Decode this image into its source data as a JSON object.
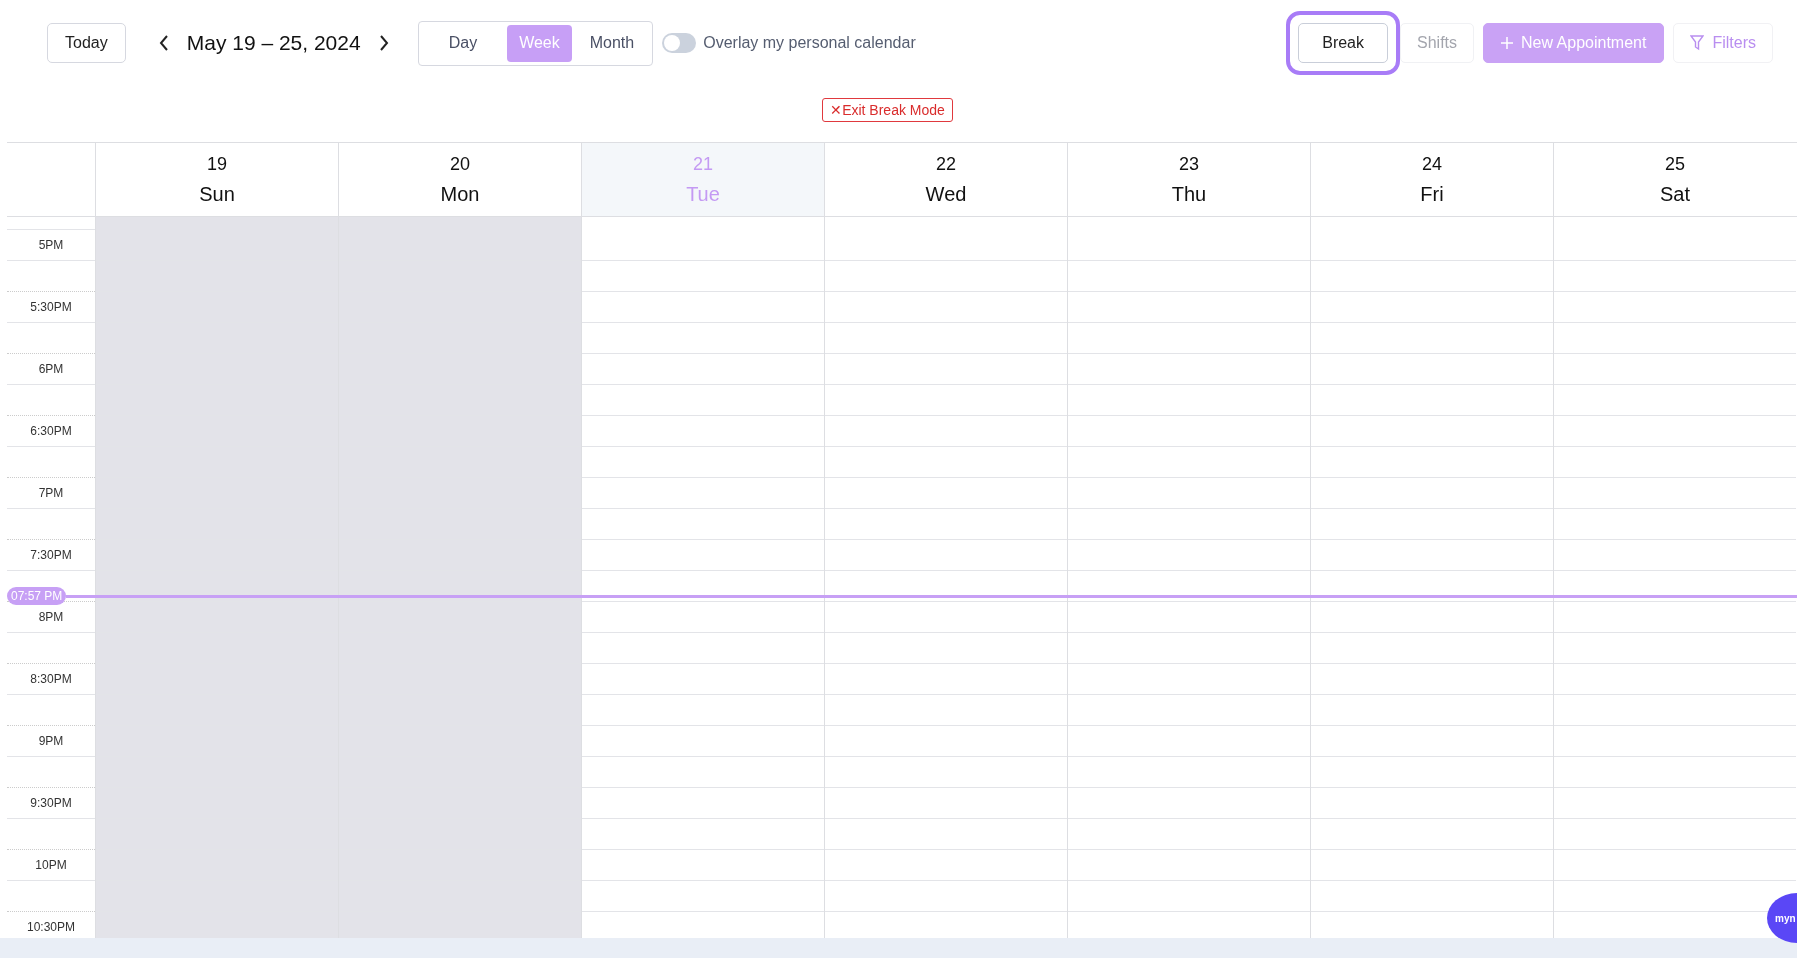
{
  "toolbar": {
    "today": "Today",
    "range": "May 19 – 25, 2024",
    "views": [
      {
        "label": "Day",
        "selected": false
      },
      {
        "label": "Week",
        "selected": true
      },
      {
        "label": "Month",
        "selected": false
      }
    ],
    "overlay": {
      "label": "Overlay my personal calendar",
      "on": false
    },
    "actions": [
      {
        "label": "Break",
        "kind": "focused"
      },
      {
        "label": "Shifts",
        "kind": "plain"
      },
      {
        "label": "New Appointment",
        "kind": "primary"
      },
      {
        "label": "Filters",
        "kind": "filter"
      }
    ]
  },
  "exit_break": "✕Exit Break Mode",
  "days": [
    {
      "date": "19",
      "name": "Sun",
      "selected": false,
      "disabled": true
    },
    {
      "date": "20",
      "name": "Mon",
      "selected": false,
      "disabled": true
    },
    {
      "date": "21",
      "name": "Tue",
      "selected": true,
      "disabled": false
    },
    {
      "date": "22",
      "name": "Wed",
      "selected": false,
      "disabled": false
    },
    {
      "date": "23",
      "name": "Thu",
      "selected": false,
      "disabled": false
    },
    {
      "date": "24",
      "name": "Fri",
      "selected": false,
      "disabled": false
    },
    {
      "date": "25",
      "name": "Sat",
      "selected": false,
      "disabled": false
    }
  ],
  "times": [
    "5PM",
    "5:30PM",
    "6PM",
    "6:30PM",
    "7PM",
    "7:30PM",
    "8PM",
    "8:30PM",
    "9PM",
    "9:30PM",
    "10PM",
    "10:30PM"
  ],
  "now_label": "07:57 PM",
  "chat": "myn"
}
